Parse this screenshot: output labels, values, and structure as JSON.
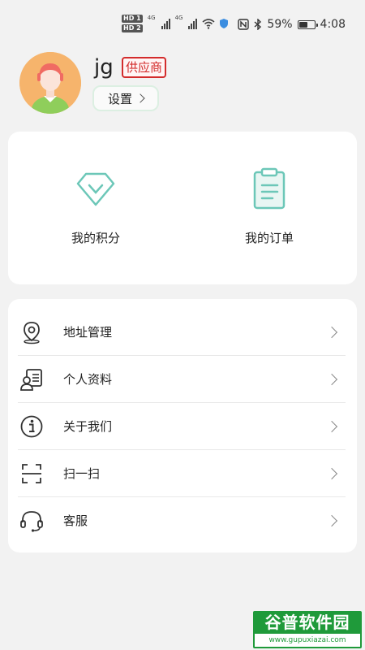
{
  "status_bar": {
    "hd1": "HD 1",
    "hd2": "HD 2",
    "net1": "4G",
    "net2": "4G",
    "battery_percent": "59%",
    "battery_level": 0.59,
    "time": "4:08",
    "icons": [
      "nfc-icon",
      "bluetooth-icon",
      "wifi-icon",
      "battery-icon"
    ]
  },
  "profile": {
    "username": "jg",
    "role_badge": "供应商",
    "settings_label": "设置"
  },
  "quick_actions": [
    {
      "label": "我的积分",
      "icon": "diamond-icon"
    },
    {
      "label": "我的订单",
      "icon": "clipboard-icon"
    }
  ],
  "menu": [
    {
      "label": "地址管理",
      "icon": "location-pin-icon"
    },
    {
      "label": "个人资料",
      "icon": "id-card-icon"
    },
    {
      "label": "关于我们",
      "icon": "info-icon"
    },
    {
      "label": "扫一扫",
      "icon": "scan-icon"
    },
    {
      "label": "客服",
      "icon": "headset-icon"
    }
  ],
  "watermark": {
    "title": "谷普软件园",
    "url": "www.gupuxiazai.com"
  },
  "colors": {
    "accent_teal": "#6cc7b8",
    "badge_red": "#d32c2c",
    "avatar_bg": "#f6b46c",
    "watermark_green": "#1f9a3a"
  }
}
